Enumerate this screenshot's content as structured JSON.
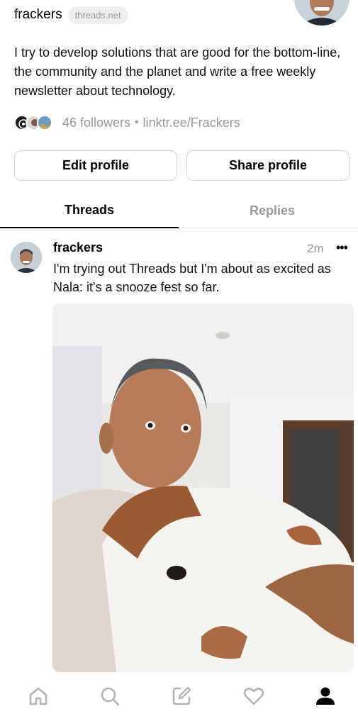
{
  "profile": {
    "username": "frackers",
    "domain_badge": "threads.net",
    "bio": "I try to develop solutions that are good for the bottom-line, the community and the planet and write a free weekly newsletter about technology.",
    "followers": "46 followers",
    "separator": "•",
    "link": "linktr.ee/Frackers"
  },
  "buttons": {
    "edit": "Edit profile",
    "share": "Share profile"
  },
  "tabs": [
    {
      "label": "Threads",
      "active": true
    },
    {
      "label": "Replies",
      "active": false
    }
  ],
  "post": {
    "author": "frackers",
    "time": "2m",
    "more": "•••",
    "text": "I'm trying out Threads but I'm about as excited as Nala: it's a snooze fest so far."
  },
  "nav": [
    {
      "icon": "home-icon"
    },
    {
      "icon": "search-icon"
    },
    {
      "icon": "compose-icon"
    },
    {
      "icon": "heart-icon"
    },
    {
      "icon": "profile-icon",
      "active": true
    }
  ],
  "colors": {
    "muted": "#999999",
    "border": "#d4d4d4",
    "badge_bg": "#efefef"
  }
}
